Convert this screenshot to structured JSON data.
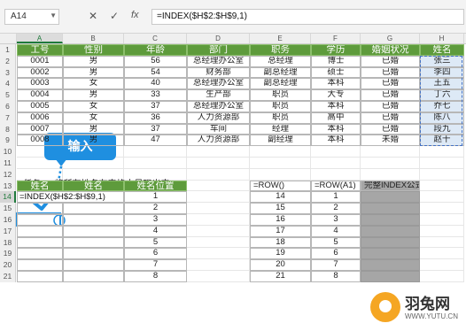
{
  "formula_bar": {
    "name_box": "A14",
    "cancel_icon": "✕",
    "enter_icon": "✓",
    "fx_icon": "fx",
    "formula": "=INDEX($H$2:$H$9,1)"
  },
  "columns": [
    "A",
    "B",
    "C",
    "D",
    "E",
    "F",
    "G",
    "H"
  ],
  "rows": [
    "1",
    "2",
    "3",
    "4",
    "5",
    "6",
    "7",
    "8",
    "9",
    "10",
    "11",
    "12",
    "13",
    "14",
    "15",
    "16",
    "17",
    "18",
    "19",
    "20",
    "21"
  ],
  "main_table": {
    "headers": [
      "工号",
      "性别",
      "年龄",
      "部门",
      "职务",
      "学历",
      "婚姻状况",
      "姓名"
    ],
    "rows": [
      [
        "0001",
        "男",
        "56",
        "总经理办公室",
        "总经理",
        "博士",
        "已婚",
        "张三"
      ],
      [
        "0002",
        "男",
        "54",
        "财务部",
        "副总经理",
        "硕士",
        "已婚",
        "李四"
      ],
      [
        "0003",
        "女",
        "40",
        "总经理办公室",
        "副总经理",
        "本科",
        "已婚",
        "王五"
      ],
      [
        "0004",
        "男",
        "33",
        "生产部",
        "职员",
        "大专",
        "已婚",
        "丁六"
      ],
      [
        "0005",
        "女",
        "37",
        "总经理办公室",
        "职员",
        "本科",
        "已婚",
        "乔七"
      ],
      [
        "0006",
        "女",
        "36",
        "人力资源部",
        "职员",
        "高中",
        "已婚",
        "陈八"
      ],
      [
        "0007",
        "男",
        "37",
        "车间",
        "经理",
        "本科",
        "已婚",
        "段九"
      ],
      [
        "0008",
        "男",
        "47",
        "人力资源部",
        "副经理",
        "本科",
        "未婚",
        "赵十"
      ]
    ]
  },
  "task": "任务1：将所有姓名在表格中呈现出来",
  "callout": "输入",
  "left_table": {
    "headers": [
      "姓名",
      "姓名",
      "姓名位置"
    ],
    "editing_cell": "=INDEX($H$2:$H$9,1)",
    "positions": [
      "1",
      "2",
      "3",
      "4",
      "5",
      "6",
      "7",
      "8"
    ]
  },
  "right_table": {
    "headers": [
      "=ROW()",
      "=ROW(A1)",
      "完整INDEX公式"
    ],
    "row_values": [
      "14",
      "15",
      "16",
      "17",
      "18",
      "19",
      "20",
      "21"
    ],
    "rowA1_values": [
      "1",
      "2",
      "3",
      "4",
      "5",
      "6",
      "7",
      "8"
    ]
  },
  "watermark": {
    "title": "羽兔网",
    "url": "WWW.YUTU.CN"
  },
  "colors": {
    "header_green": "#5e9b3c",
    "name_highlight": "#dde9f6",
    "accent_blue": "#1f8fe0",
    "gray_column": "#a6a6a6"
  }
}
